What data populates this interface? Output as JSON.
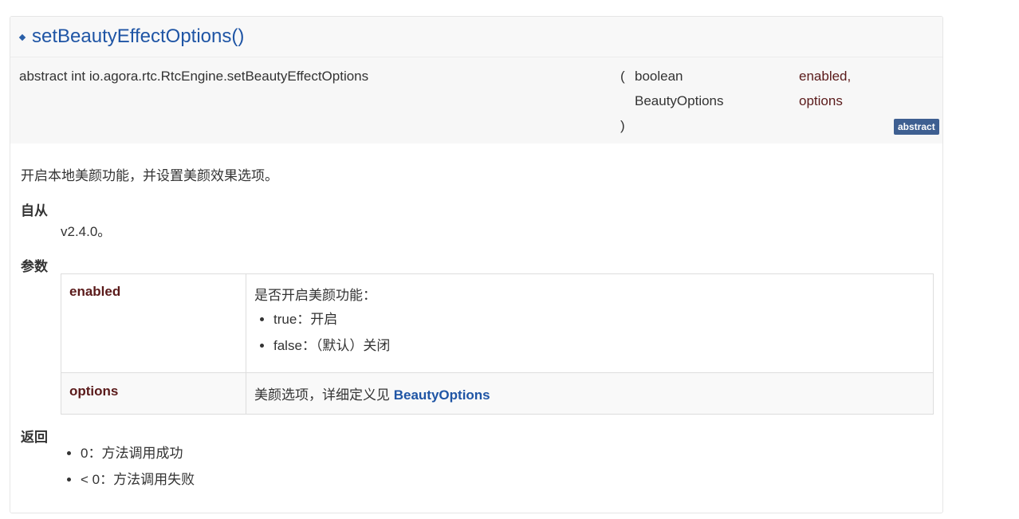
{
  "title": "setBeautyEffectOptions()",
  "signature": {
    "declaration": "abstract int io.agora.rtc.RtcEngine.setBeautyEffectOptions",
    "paren_open": "(",
    "paren_close": ")",
    "params": [
      {
        "type": "boolean",
        "name": "enabled,"
      },
      {
        "type": "BeautyOptions",
        "name": "options"
      }
    ],
    "badge": "abstract"
  },
  "description": "开启本地美颜功能，并设置美颜效果选项。",
  "since": {
    "heading": "自从",
    "value": "v2.4.0。"
  },
  "params_section": {
    "heading": "参数",
    "rows": [
      {
        "name": "enabled",
        "desc": "是否开启美颜功能：",
        "bullets": [
          "true：开启",
          "false：（默认）关闭"
        ]
      },
      {
        "name": "options",
        "desc_prefix": "美颜选项，详细定义见 ",
        "link": "BeautyOptions"
      }
    ]
  },
  "returns": {
    "heading": "返回",
    "items": [
      "0：方法调用成功",
      "< 0：方法调用失败"
    ]
  }
}
